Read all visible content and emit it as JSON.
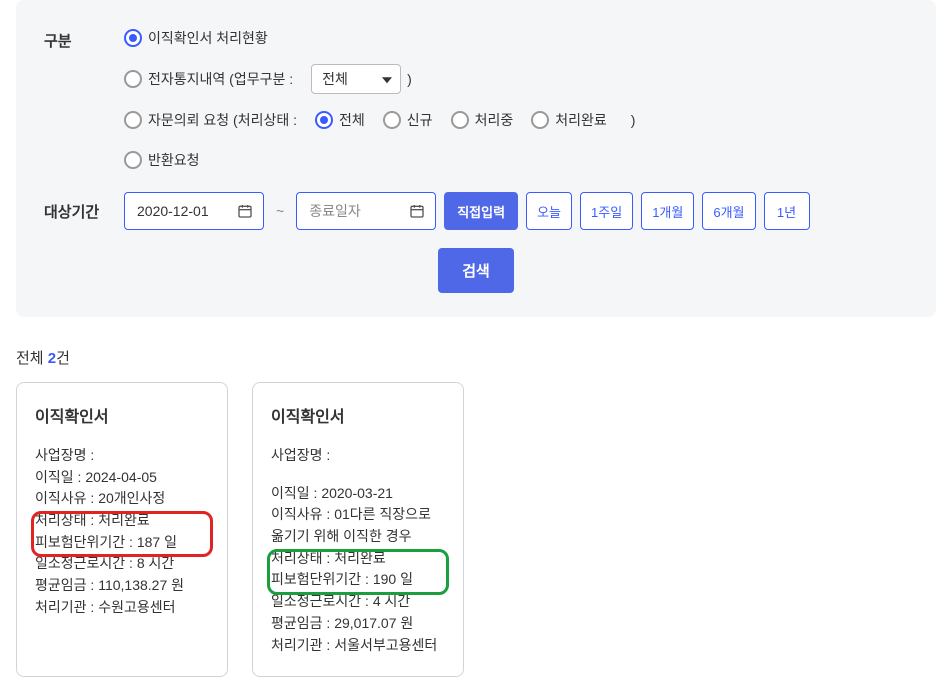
{
  "filter": {
    "gubun_label": "구분",
    "options": {
      "opt1": "이직확인서 처리현황",
      "opt2_prefix": "전자통지내역 (업무구분 : ",
      "opt2_select": "전체",
      "opt3_prefix": "자문의뢰 요청 (처리상태 :",
      "opt3_status": {
        "all": "전체",
        "new": "신규",
        "processing": "처리중",
        "done": "처리완료"
      },
      "opt4": "반환요청"
    },
    "period_label": "대상기간",
    "start_date": "2020-12-01",
    "end_placeholder": "종료일자",
    "direct_input": "직접입력",
    "presets": {
      "today": "오늘",
      "week1": "1주일",
      "month1": "1개월",
      "month6": "6개월",
      "year1": "1년"
    },
    "search": "검색"
  },
  "results": {
    "prefix": "전체 ",
    "count": "2",
    "suffix": "건",
    "cards": [
      {
        "title": "이직확인서",
        "biz_name_label": "사업장명 :",
        "biz_name": "",
        "leave_date_label": "이직일 : ",
        "leave_date": "2024-04-05",
        "reason_label": "이직사유 : ",
        "reason": "20개인사정",
        "status_label": "처리상태 : ",
        "status": "처리완료",
        "insured_label": "피보험단위기간 : ",
        "insured": "187 일",
        "hours_label": "일소정근로시간 : ",
        "hours": "8 시간",
        "avg_label": "평균임금 : ",
        "avg": "110,138.27 원",
        "org_label": "처리기관 : ",
        "org": "수원고용센터"
      },
      {
        "title": "이직확인서",
        "biz_name_label": "사업장명 :",
        "biz_name": "",
        "leave_date_label": "이직일 : ",
        "leave_date": "2020-03-21",
        "reason_label": "이직사유 : ",
        "reason": "01다른 직장으로 옮기기 위해 이직한 경우",
        "status_label": "처리상태 : ",
        "status": "처리완료",
        "insured_label": "피보험단위기간 : ",
        "insured": "190 일",
        "hours_label": "일소정근로시간 : ",
        "hours": "4 시간",
        "avg_label": "평균임금 : ",
        "avg": "29,017.07 원",
        "org_label": "처리기관 : ",
        "org": "서울서부고용센터"
      }
    ]
  }
}
